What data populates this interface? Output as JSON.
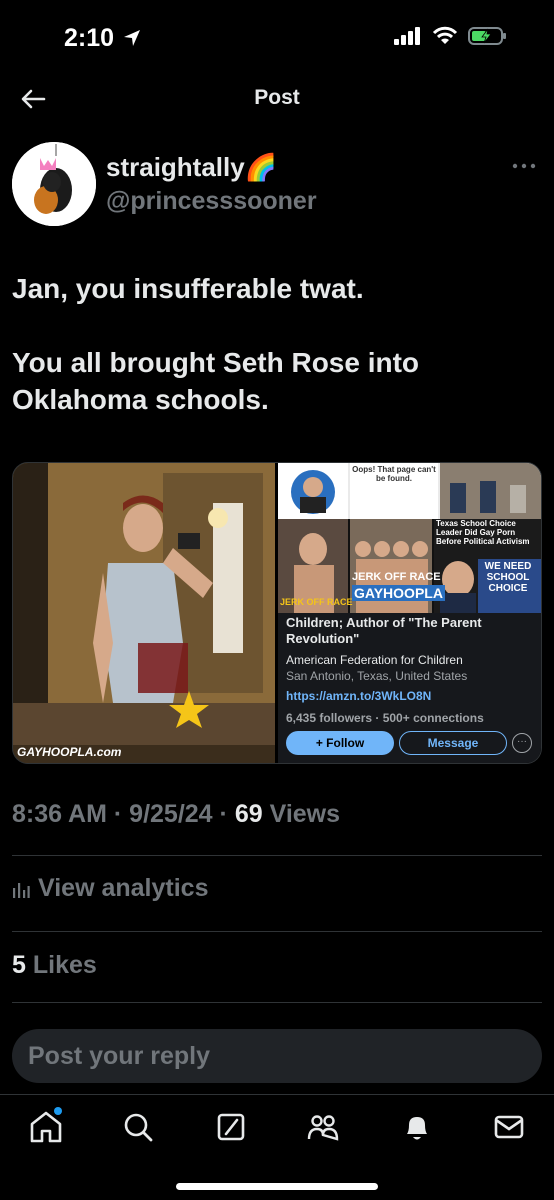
{
  "status": {
    "time": "2:10"
  },
  "nav": {
    "title": "Post"
  },
  "author": {
    "display_name": "straightally🌈",
    "handle": "@princesssooner"
  },
  "tweet": {
    "lines": [
      "Jan, you insufferable twat.",
      "You all brought Seth Rose into Oklahoma schools."
    ]
  },
  "media": {
    "left_watermark": "GAYHOOPLA.com",
    "right": {
      "error_title": "Oops! That page can't be found.",
      "headline": "Texas School Choice Leader Did Gay Porn Before Political Activism",
      "label_jerk": "JERK OFF RACE",
      "label_gayhoopla": "GAYHOOPLA",
      "label_jerk2": "JERK OFF RACE",
      "banner": "WE NEED SCHOOL CHOICE",
      "bio": "Children; Author of \"The Parent Revolution\"",
      "org": "American Federation for Children",
      "location": "San Antonio, Texas, United States",
      "link": "https://amzn.to/3WkLO8N",
      "followers": "6,435 followers · 500+ connections",
      "follow_label": "+ Follow",
      "message_label": "Message"
    }
  },
  "meta": {
    "time": "8:36 AM",
    "date": "9/25/24",
    "views_count": "69",
    "views_label": "Views"
  },
  "analytics_label": "View analytics",
  "likes": {
    "count": "5",
    "label": "Likes"
  },
  "reply_placeholder": "Post your reply",
  "colors": {
    "accent": "#1d9bf0",
    "background": "#000000",
    "text": "#e7e9ea",
    "muted": "#71767b"
  },
  "icons": [
    "location-arrow-icon",
    "signal-icon",
    "wifi-icon",
    "battery-charging-icon",
    "back-arrow-icon",
    "more-icon",
    "analytics-icon",
    "home-icon",
    "search-icon",
    "grok-icon",
    "communities-icon",
    "notifications-icon",
    "messages-icon"
  ]
}
